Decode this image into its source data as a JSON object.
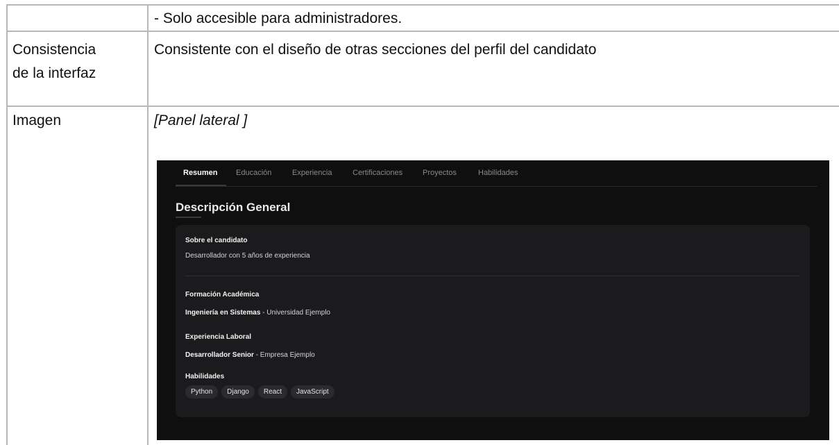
{
  "table": {
    "rows": [
      {
        "label": "",
        "value": "- Solo accesible para administradores."
      },
      {
        "label_line1": "Consistencia",
        "label_line2": "de la interfaz",
        "value": "Consistente con el diseño de otras secciones del perfil del candidato"
      },
      {
        "label": "Imagen",
        "value": "[Panel lateral ]"
      }
    ]
  },
  "panel": {
    "tabs": [
      "Resumen",
      "Educación",
      "Experiencia",
      "Certificaciones",
      "Proyectos",
      "Habilidades"
    ],
    "active_tab": "Resumen",
    "section_title": "Descripción General",
    "about_label": "Sobre el candidato",
    "about_text": "Desarrollador con 5 años de experiencia",
    "education_label": "Formación Académica",
    "education_degree": "Ingeniería en Sistemas",
    "education_institution": " - Universidad Ejemplo",
    "experience_label": "Experiencia Laboral",
    "experience_role": "Desarrollador Senior",
    "experience_company": " - Empresa Ejemplo",
    "skills_label": "Habilidades",
    "skills": [
      "Python",
      "Django",
      "React",
      "JavaScript"
    ]
  }
}
